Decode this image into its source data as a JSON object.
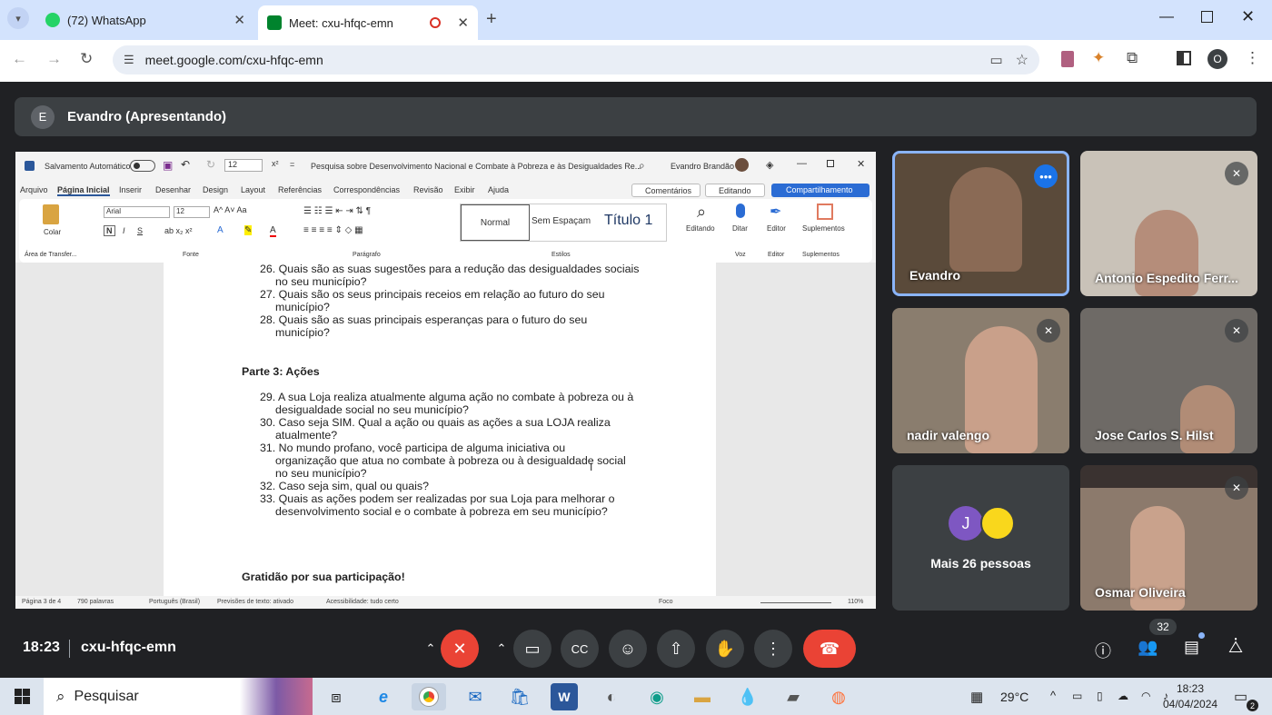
{
  "browser": {
    "tabs": [
      {
        "label": "(72) WhatsApp",
        "icon": "whatsapp-icon"
      },
      {
        "label": "Meet: cxu-hfqc-emn",
        "icon": "meet-icon"
      }
    ],
    "url": "meet.google.com/cxu-hfqc-emn",
    "profile_initial": "O"
  },
  "meet": {
    "presenter_initial": "E",
    "presenter_label": "Evandro (Apresentando)",
    "time": "18:23",
    "meeting_code": "cxu-hfqc-emn",
    "participant_count": "32",
    "colors": {
      "end_call": "#ea4335",
      "mic_off": "#ea4335",
      "accent": "#8ab4f8"
    }
  },
  "word": {
    "autosave": "Salvamento Automático",
    "font_size_box": "12",
    "doc_title": "Pesquisa sobre Desenvolvimento Nacional e Combate à Pobreza e às Desigualdades Re...",
    "user": "Evandro Brandão",
    "menu": [
      "Arquivo",
      "Página Inicial",
      "Inserir",
      "Desenhar",
      "Design",
      "Layout",
      "Referências",
      "Correspondências",
      "Revisão",
      "Exibir",
      "Ajuda"
    ],
    "comments_btn": "Comentários",
    "editing_btn": "Editando",
    "share_btn": "Compartilhamento",
    "ribbon": {
      "paste": "Colar",
      "font_name": "Arial",
      "font_size": "12",
      "styles": [
        "Normal",
        "Sem Espaçam",
        "Título 1"
      ],
      "editing": "Editando",
      "dictate": "Ditar",
      "editor": "Editor",
      "addins": "Suplementos",
      "groups": [
        "Área de Transfer...",
        "Fonte",
        "Parágrafo",
        "Estilos",
        "Voz",
        "Editor",
        "Suplementos"
      ]
    },
    "doc": {
      "lines": [
        "26. Quais são as suas sugestões para a redução das desigualdades sociais",
        "no seu município?",
        "27. Quais são os seus principais receios em relação ao futuro do seu",
        "município?",
        "28. Quais são as suas principais esperanças para o futuro do seu",
        "município?"
      ],
      "section": "Parte 3: Ações",
      "lines2": [
        "29.  A sua Loja realiza atualmente alguma ação no combate à pobreza ou à",
        "desigualdade  social no seu município?",
        "30. Caso seja SIM. Qual a ação ou quais as  ações a sua LOJA realiza",
        "atualmente?",
        "31. No mundo profano, você participa de alguma iniciativa  ou",
        "organização  que atua no combate à pobreza ou à desigualdade social",
        "no seu município?",
        "32. Caso seja sim, qual ou quais?",
        "33. Quais as ações podem ser realizadas por sua Loja  para melhorar o",
        "desenvolvimento social e o combate à pobreza em seu município?"
      ],
      "closing": "Gratidão por sua participação!"
    },
    "status": {
      "page": "Página 3 de 4",
      "words": "790 palavras",
      "lang": "Português (Brasil)",
      "predict": "Previsões de texto: ativado",
      "access": "Acessibilidade: tudo certo",
      "focus": "Foco",
      "zoom": "110%"
    }
  },
  "participants": [
    {
      "name": "Evandro",
      "muted": false
    },
    {
      "name": "Antonio Espedito Ferr...",
      "muted": true
    },
    {
      "name": "nadir valengo",
      "muted": true
    },
    {
      "name": "Jose Carlos S. Hilst",
      "muted": true
    },
    {
      "name": "Mais 26 pessoas",
      "avatar": "J"
    },
    {
      "name": "Osmar Oliveira",
      "muted": true
    }
  ],
  "taskbar": {
    "search": "Pesquisar",
    "weather": "29°C",
    "clock_time": "18:23",
    "clock_date": "04/04/2024",
    "notif": "2"
  }
}
